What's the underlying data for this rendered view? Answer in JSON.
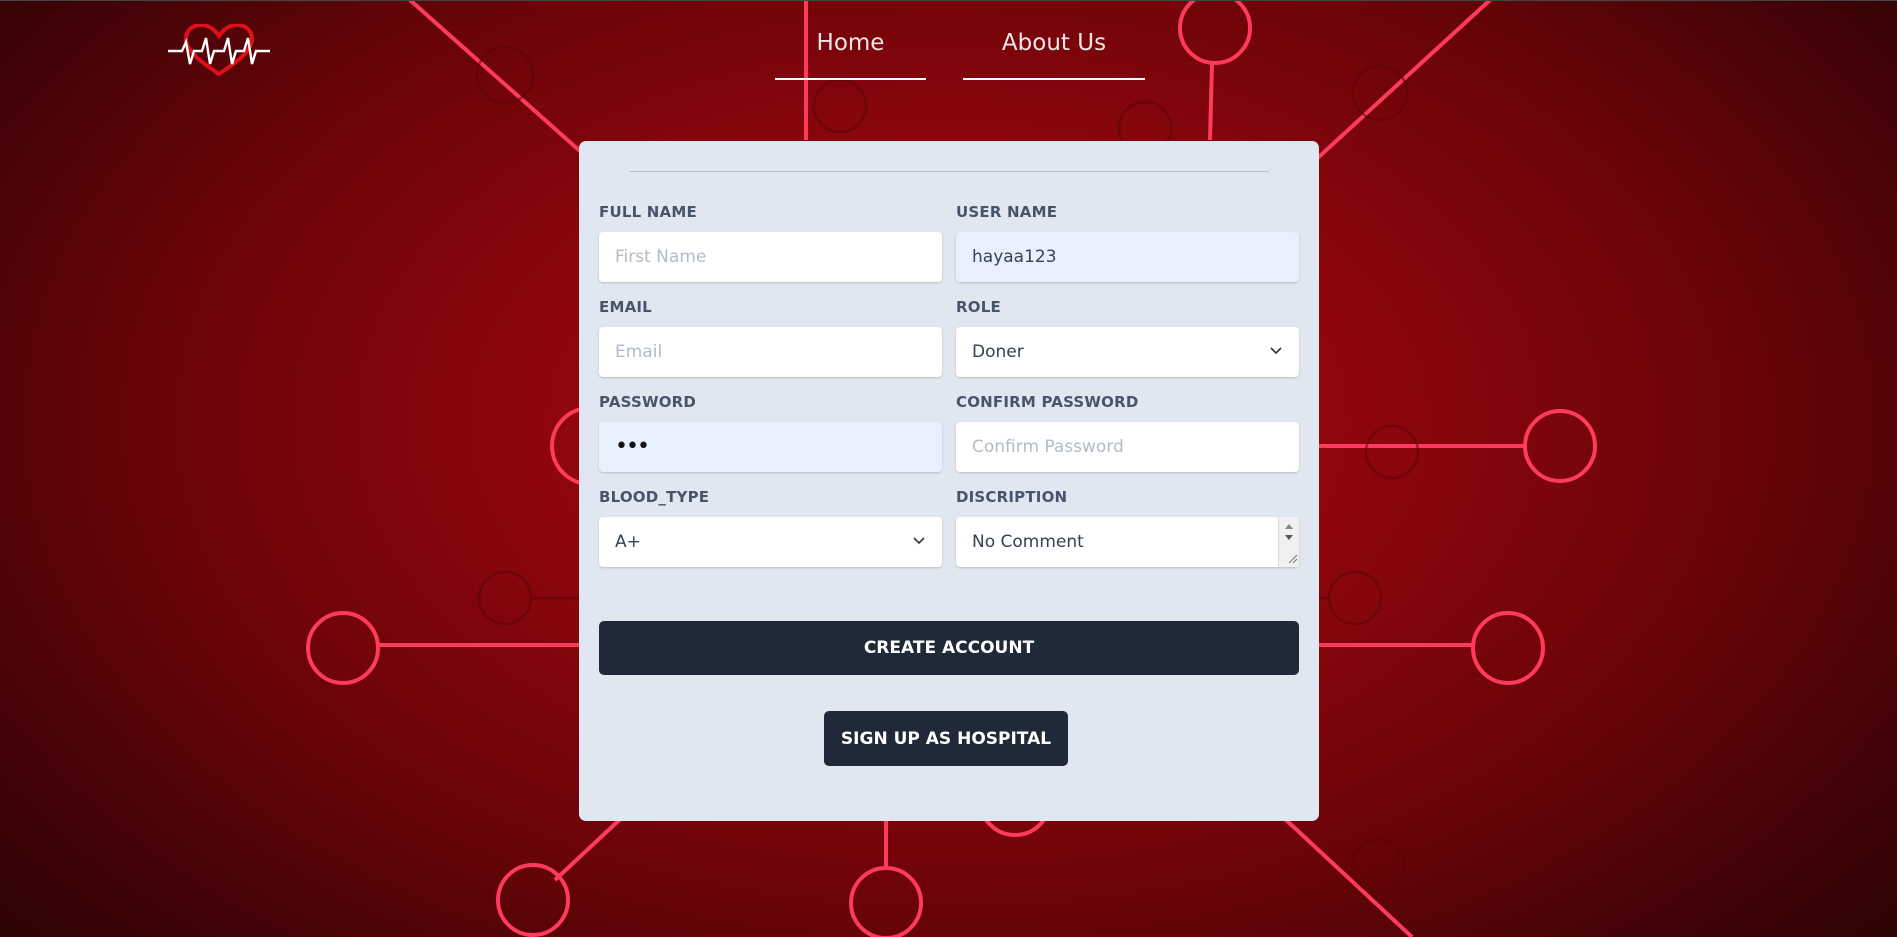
{
  "nav": {
    "home": "Home",
    "about": "About Us"
  },
  "form": {
    "full_name": {
      "label": "FULL NAME",
      "value": "",
      "placeholder": "First Name"
    },
    "user_name": {
      "label": "USER NAME",
      "value": "hayaa123",
      "placeholder": ""
    },
    "email": {
      "label": "EMAIL",
      "value": "",
      "placeholder": "Email"
    },
    "role": {
      "label": "ROLE",
      "selected": "Doner"
    },
    "password": {
      "label": "PASSWORD",
      "value": "•••"
    },
    "confirm_password": {
      "label": "CONFIRM PASSWORD",
      "value": "",
      "placeholder": "Confirm Password"
    },
    "blood_type": {
      "label": "BLOOD_TYPE",
      "selected": "A+"
    },
    "description": {
      "label": "DISCRIPTION",
      "value": "No Comment"
    },
    "create_account": "CREATE ACCOUNT",
    "signup_hospital": "SIGN UP AS HOSPITAL"
  },
  "colors": {
    "accent_line": "#ff3a5c",
    "button": "#1f2937",
    "card": "#e1e7f0"
  },
  "icons": {
    "logo": "heart-pulse-logo",
    "select_arrow": "chevron-down-icon"
  }
}
